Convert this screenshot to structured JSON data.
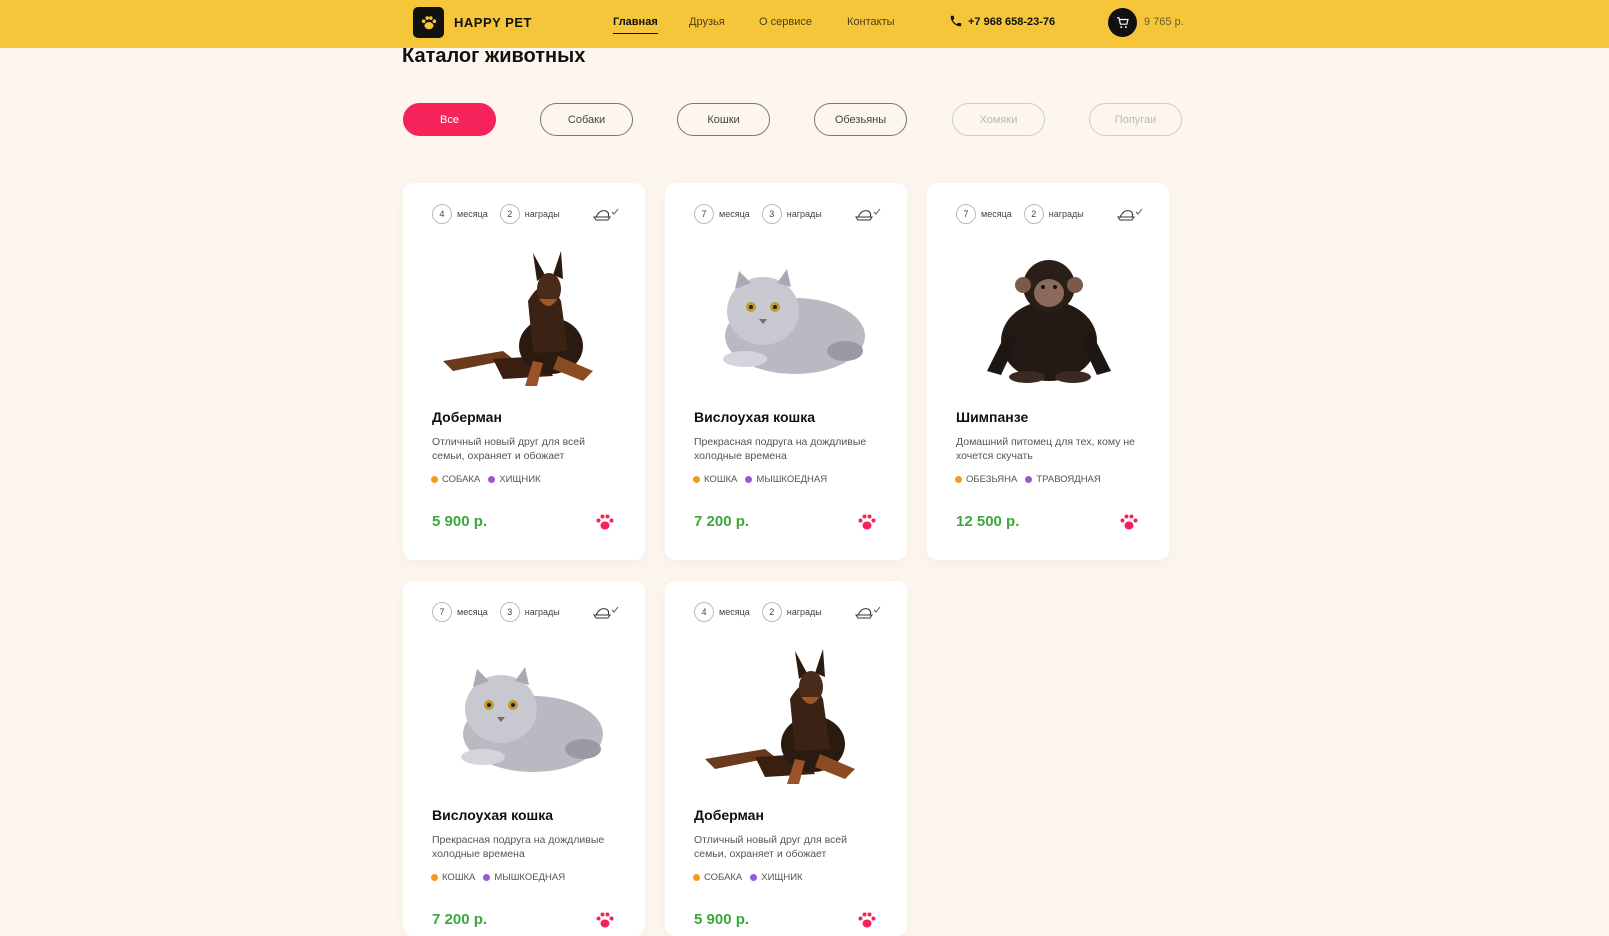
{
  "header": {
    "brand": "HAPPY PET",
    "nav": [
      "Главная",
      "Друзья",
      "О сервисе",
      "Контакты"
    ],
    "phone": "+7 968 658-23-76",
    "cart_total": "9 765 р."
  },
  "page": {
    "title": "Каталог животных"
  },
  "filters": [
    "Все",
    "Собаки",
    "Кошки",
    "Обезьяны",
    "Хомяки",
    "Попугаи"
  ],
  "cards": [
    {
      "months": "4",
      "months_label": "месяца",
      "awards": "2",
      "awards_label": "награды",
      "name": "Доберман",
      "desc": "Отличный новый друг для всей семьи, охраняет и обожает",
      "tag1": "СОБАКА",
      "tag2": "ХИЩНИК",
      "price": "5 900 р.",
      "animal": "dog"
    },
    {
      "months": "7",
      "months_label": "месяца",
      "awards": "3",
      "awards_label": "награды",
      "name": "Вислоухая кошка",
      "desc": "Прекрасная подруга на дождливые холодные времена",
      "tag1": "КОШКА",
      "tag2": "МЫШКОЕДНАЯ",
      "price": "7 200 р.",
      "animal": "cat"
    },
    {
      "months": "7",
      "months_label": "месяца",
      "awards": "2",
      "awards_label": "награды",
      "name": "Шимпанзе",
      "desc": "Домашний питомец для тех, кому не хочется скучать",
      "tag1": "ОБЕЗЬЯНА",
      "tag2": "ТРАВОЯДНАЯ",
      "price": "12 500 р.",
      "animal": "monkey"
    },
    {
      "months": "7",
      "months_label": "месяца",
      "awards": "3",
      "awards_label": "награды",
      "name": "Вислоухая кошка",
      "desc": "Прекрасная подруга на дождливые холодные времена",
      "tag1": "КОШКА",
      "tag2": "МЫШКОЕДНАЯ",
      "price": "7 200 р.",
      "animal": "cat"
    },
    {
      "months": "4",
      "months_label": "месяца",
      "awards": "2",
      "awards_label": "награды",
      "name": "Доберман",
      "desc": "Отличный новый друг для всей семьи, охраняет и обожает",
      "tag1": "СОБАКА",
      "tag2": "ХИЩНИК",
      "price": "5 900 р.",
      "animal": "dog"
    }
  ],
  "colors": {
    "header": "#f5c63a",
    "accent": "#f5235a",
    "price": "#3aa83a",
    "background": "#fcf6ee"
  }
}
